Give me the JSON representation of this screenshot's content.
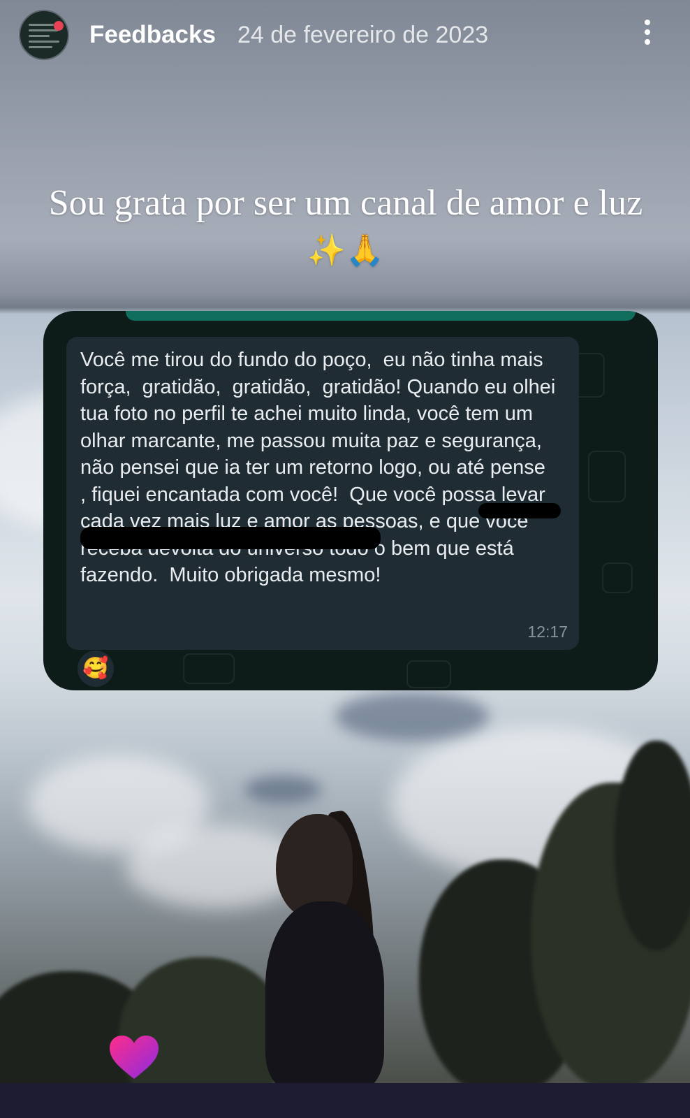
{
  "header": {
    "title": "Feedbacks",
    "date": "24 de fevereiro de 2023",
    "avatar_icon": "story-highlight-thumbnail",
    "menu_icon": "more-vertical-icon"
  },
  "caption": {
    "text": "Sou grata por ser um canal de amor e luz",
    "emojis": [
      "sparkles",
      "folded-hands"
    ]
  },
  "chat": {
    "message": "Você me tirou do fundo do poço,  eu não tinha mais força,  gratidão,  gratidão,  gratidão! Quando eu olhei tua foto no perfil te achei muito linda, você tem um olhar marcante, me passou muita paz e segurança,  não pensei que ia ter um retorno logo, ou até pense                                     , fiquei encantada com você!  Que você possa levar cada vez mais luz e amor as pessoas, e que você receba devolta do universo todo o bem que está fazendo.  Muito obrigada mesmo!",
    "time": "12:17",
    "reaction": "smiling-face-with-hearts"
  },
  "colors": {
    "bubble": "#1f2c34",
    "card": "#0e1c19",
    "accent_strip": "#0f6e5c",
    "heart_start": "#ff2d8a",
    "heart_end": "#8a2be2"
  }
}
